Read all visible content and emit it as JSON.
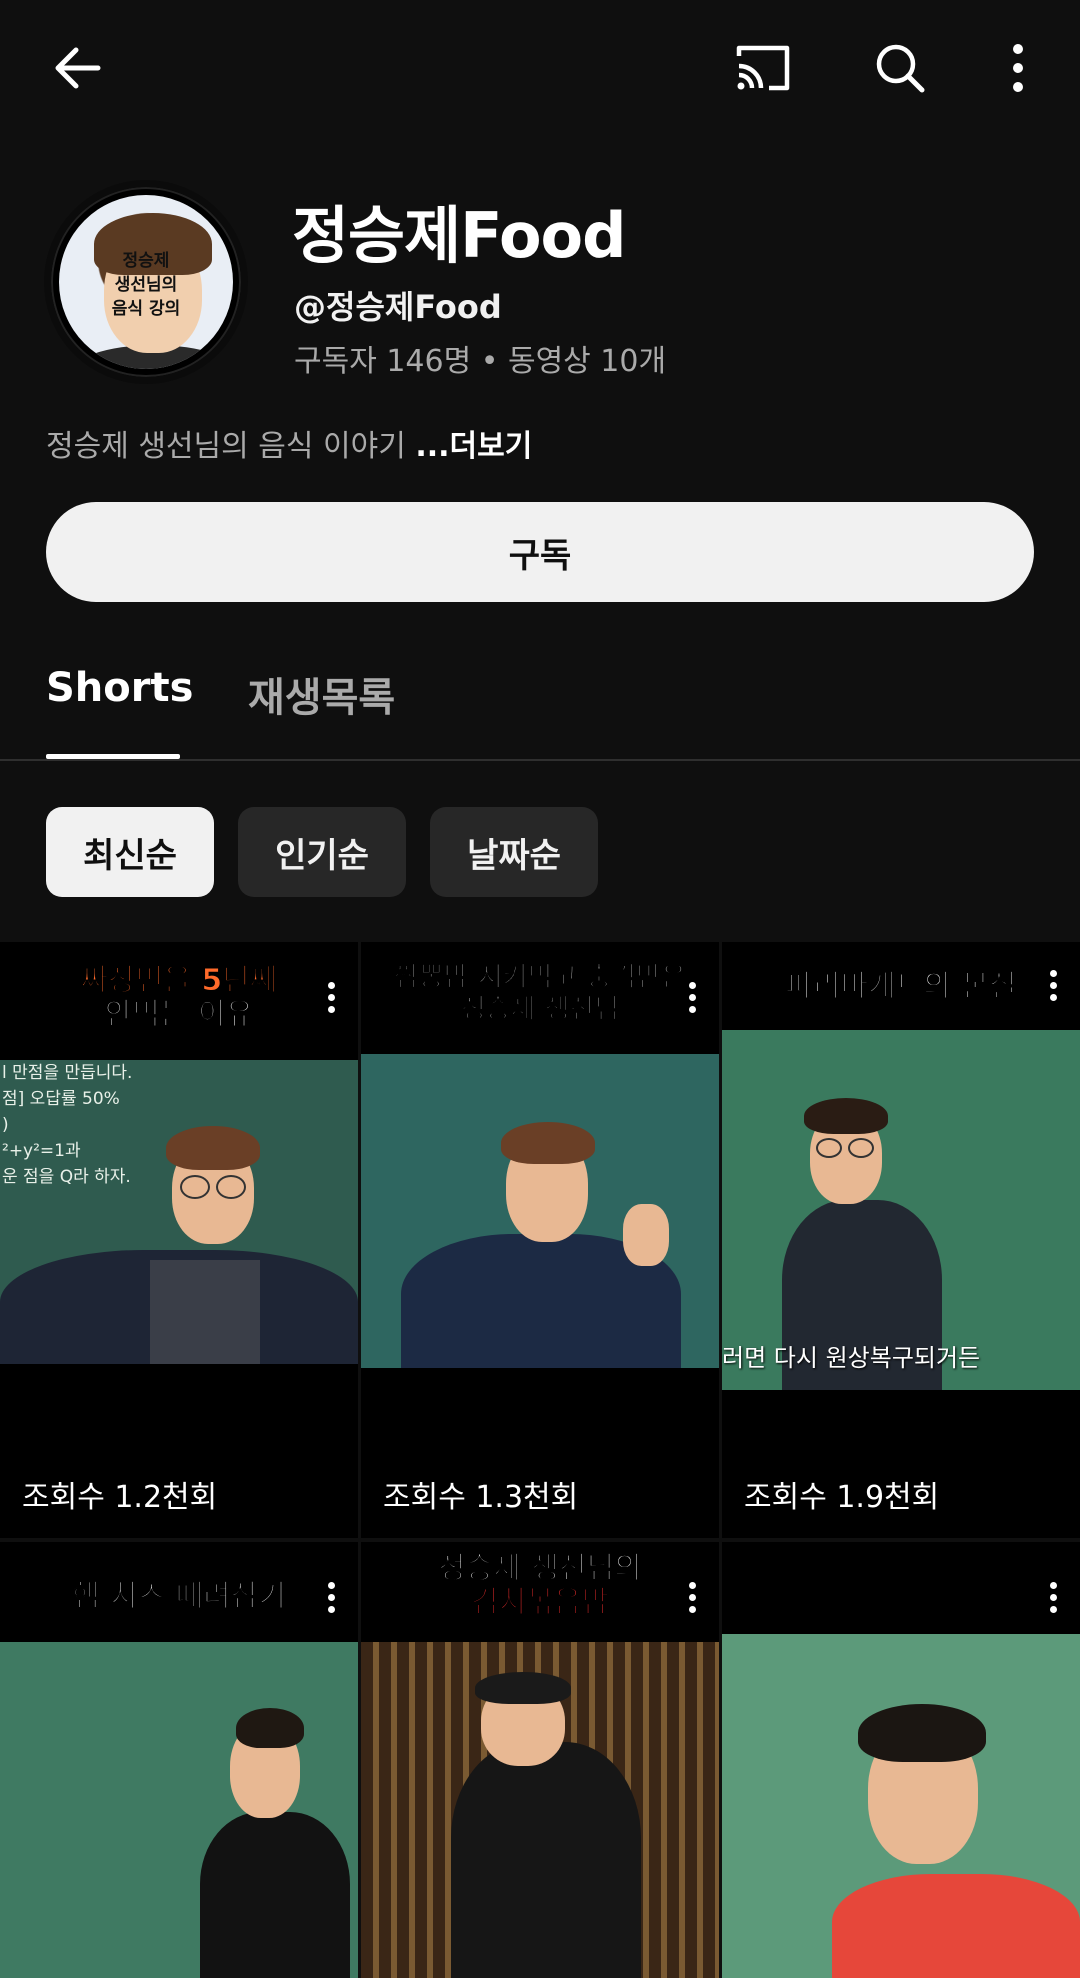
{
  "topbar": {
    "back_icon": "arrow-left-icon",
    "cast_icon": "cast-icon",
    "search_icon": "search-icon",
    "more_icon": "more-vertical-icon"
  },
  "channel": {
    "avatar_text": "정승제\n생선님의\n음식 강의",
    "name": "정승제Food",
    "handle": "@정승제Food",
    "stats": "구독자 146명 • 동영상 10개",
    "description": "정승제 생선님의 음식 이야기 ",
    "more_label": "...더보기",
    "subscribe_label": "구독"
  },
  "tabs": [
    {
      "label": "Shorts",
      "selected": true
    },
    {
      "label": "재생목록",
      "selected": false
    }
  ],
  "chips": [
    {
      "label": "최신순",
      "selected": true
    },
    {
      "label": "인기순",
      "selected": false
    },
    {
      "label": "날짜순",
      "selected": false
    }
  ],
  "shorts": [
    {
      "caption_lines": [
        "짜장면을 5년째",
        "안먹는 이유"
      ],
      "views": "조회수 1.2천회",
      "board_text": "l 만점을 만듭니다.\n점] 오답률 50%\n)\n²+y²=1과\n운 점을 Q라 하자.",
      "caption_color": "#ff6a2a"
    },
    {
      "caption_lines": [
        "짬뽕밥 시켜먹고 충격받은",
        "정승제 생선님"
      ],
      "views": "조회수 1.3천회",
      "caption_color": "#ff3a3a"
    },
    {
      "caption_lines": [
        "파리바게트의 본질"
      ],
      "views": "조회수 1.9천회",
      "subtitle": "러면 다시 원상복구되거든",
      "caption_color": "#3a6bff"
    },
    {
      "caption_lines": [
        "햄 치즈 때려잡기"
      ],
      "views": "",
      "caption_color": "#ff4aa0"
    },
    {
      "caption_lines": [
        "정승제 생선님의",
        "김치볶음밥"
      ],
      "views": "",
      "caption_color": "#ff3030"
    },
    {
      "caption_lines": [],
      "views": "",
      "caption_color": "#ffffff"
    }
  ]
}
